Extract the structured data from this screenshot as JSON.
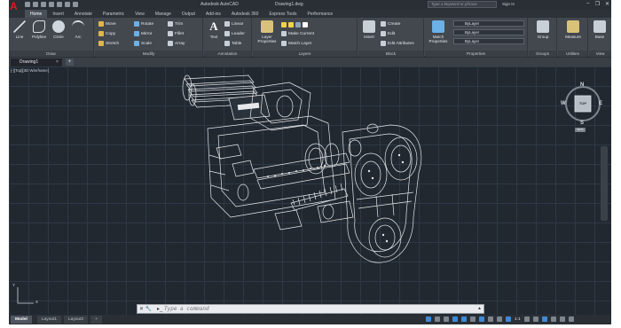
{
  "window": {
    "app_title": "Autodesk AutoCAD",
    "doc_title": "Drawing1.dwg",
    "search_placeholder": "Type a keyword or phrase",
    "sign_in": "Sign In",
    "app_logo_letter": "A",
    "controls": [
      "–",
      "❐",
      "✕"
    ]
  },
  "ribbon_tabs": [
    "Home",
    "Insert",
    "Annotate",
    "Parametric",
    "View",
    "Manage",
    "Output",
    "Add-ins",
    "Autodesk 360",
    "Express Tools",
    "Performance"
  ],
  "ribbon_active_tab": "Home",
  "ribbon": {
    "draw": {
      "label": "Draw",
      "tools": [
        "Line",
        "Polyline",
        "Circle",
        "Arc"
      ]
    },
    "modify": {
      "label": "Modify",
      "rows": [
        [
          "Move",
          "Rotate",
          "Trim"
        ],
        [
          "Copy",
          "Mirror",
          "Fillet"
        ],
        [
          "Stretch",
          "Scale",
          "Array"
        ]
      ]
    },
    "annotation": {
      "label": "Annotation",
      "text": "Text",
      "dimension": "Linear",
      "leader": "Leader",
      "table": "Table"
    },
    "layers": {
      "label": "Layers",
      "properties": "Layer Properties",
      "make_current": "Make Current",
      "match_layer": "Match Layer"
    },
    "block": {
      "label": "Block",
      "insert": "Insert",
      "create": "Create",
      "edit": "Edit",
      "edit_attributes": "Edit Attributes"
    },
    "properties": {
      "label": "Properties",
      "match": "Match Properties",
      "dropdowns": [
        "ByLayer",
        "ByLayer",
        "ByLayer"
      ]
    },
    "groups": {
      "label": "Groups",
      "group": "Group"
    },
    "utilities": {
      "label": "Utilities",
      "measure": "Measure"
    },
    "view": {
      "label": "View",
      "base": "Base"
    }
  },
  "file_tab": {
    "name": "Drawing1",
    "close": "×",
    "new": "+"
  },
  "viewport": {
    "label": "[-][Top][3D Wireframe]",
    "viewcube": {
      "n": "N",
      "s": "S",
      "e": "E",
      "w": "W",
      "face": "TOP",
      "wcs": "WCS"
    },
    "ucs": {
      "x": "X",
      "y": "Y"
    }
  },
  "command_line": {
    "icons": "✕ 🔧",
    "placeholder": "Type a command",
    "prompt": "▸_",
    "dropdown": "▲"
  },
  "layout_tabs": [
    "Model",
    "Layout1",
    "Layout2"
  ],
  "layout_add": "+",
  "status": {
    "scale": "1:1"
  },
  "colors": {
    "accent": "#3f8ad6",
    "background": "#212830",
    "wireframe": "#e6e8ea",
    "ribbon": "#43484f"
  }
}
